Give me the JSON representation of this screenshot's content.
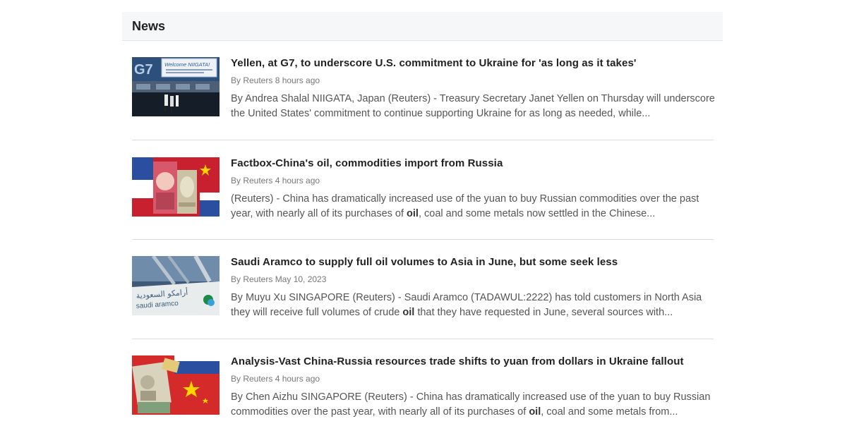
{
  "panel": {
    "title": "News"
  },
  "articles": [
    {
      "headline": "Yellen, at G7, to underscore U.S. commitment to Ukraine for 'as long as it takes'",
      "meta": "By Reuters 8 hours ago",
      "summary_before": "By Andrea Shalal NIIGATA, Japan (Reuters) - Treasury Secretary Janet Yellen on Thursday will underscore the United States' commitment to continue supporting Ukraine for as long as needed, while...",
      "highlight": "",
      "summary_after": "",
      "thumb": {
        "sign_text": "Welcome NIIGATA!",
        "logo_text": "G7"
      }
    },
    {
      "headline": "Factbox-China's oil, commodities import from Russia",
      "meta": "By Reuters 4 hours ago",
      "summary_before": "(Reuters) - China has dramatically increased use of the yuan to buy Russian commodities over the past year, with nearly all of its purchases of ",
      "highlight": "oil",
      "summary_after": ", coal and some metals now settled in the Chinese...",
      "thumb": {}
    },
    {
      "headline": "Saudi Aramco to supply full oil volumes to Asia in June, but some seek less",
      "meta": "By Reuters May 10, 2023",
      "summary_before": "By Muyu Xu SINGAPORE (Reuters) - Saudi Aramco (TADAWUL:2222) has told customers in North Asia they will receive full volumes of crude ",
      "highlight": "oil",
      "summary_after": " that they have requested in June, several sources with...",
      "thumb": {
        "sign_arabic": "أرامكو السعودية",
        "sign_latin": "saudi aramco"
      }
    },
    {
      "headline": "Analysis-Vast China-Russia resources trade shifts to yuan from dollars in Ukraine fallout",
      "meta": "By Reuters 4 hours ago",
      "summary_before": "By Chen Aizhu SINGAPORE (Reuters) - China has dramatically increased use of the yuan to buy Russian commodities over the past year, with nearly all of its purchases of ",
      "highlight": "oil",
      "summary_after": ", coal and some metals from...",
      "thumb": {}
    }
  ]
}
